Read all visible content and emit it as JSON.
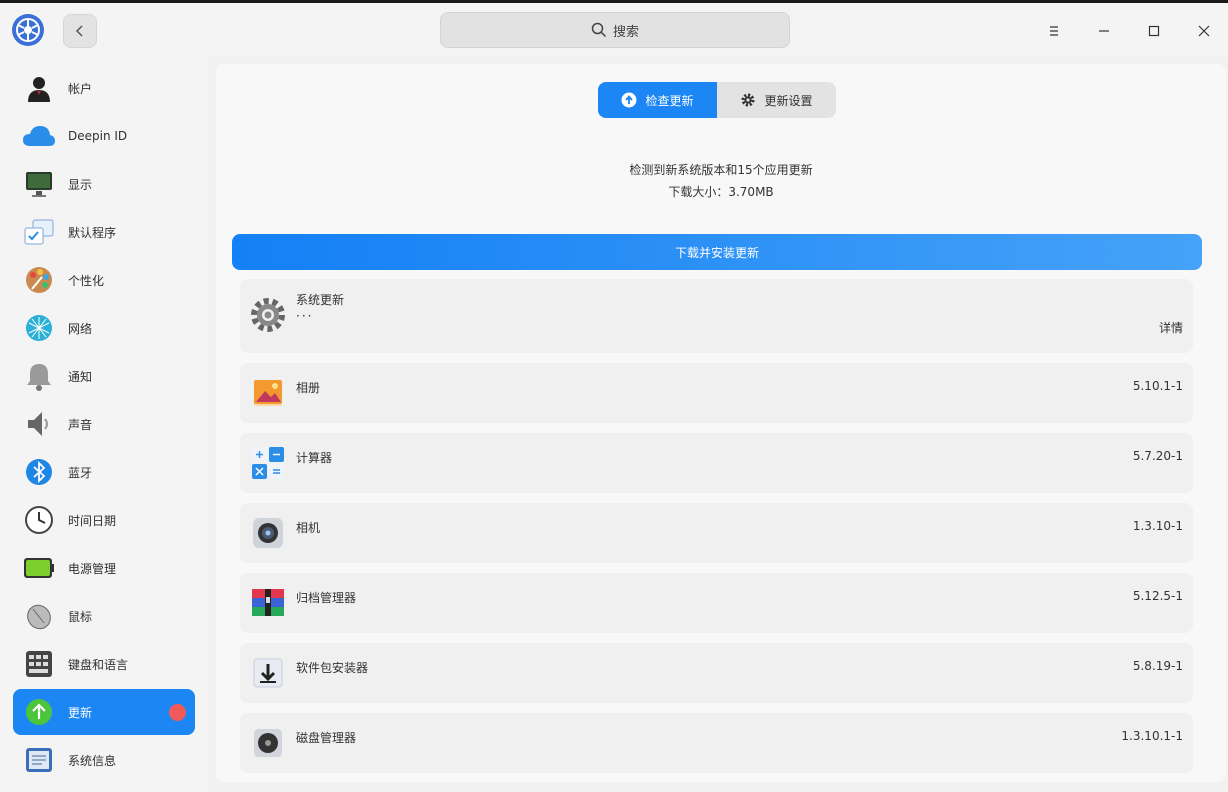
{
  "titlebar": {
    "search_placeholder": "搜索"
  },
  "sidebar": {
    "items": [
      {
        "label": "帐户",
        "icon": "account-icon"
      },
      {
        "label": "Deepin ID",
        "icon": "cloud-icon"
      },
      {
        "label": "显示",
        "icon": "display-icon"
      },
      {
        "label": "默认程序",
        "icon": "default-apps-icon"
      },
      {
        "label": "个性化",
        "icon": "palette-icon"
      },
      {
        "label": "网络",
        "icon": "network-icon"
      },
      {
        "label": "通知",
        "icon": "bell-icon"
      },
      {
        "label": "声音",
        "icon": "speaker-icon"
      },
      {
        "label": "蓝牙",
        "icon": "bluetooth-icon"
      },
      {
        "label": "时间日期",
        "icon": "clock-icon"
      },
      {
        "label": "电源管理",
        "icon": "battery-icon"
      },
      {
        "label": "鼠标",
        "icon": "mouse-icon"
      },
      {
        "label": "键盘和语言",
        "icon": "keyboard-icon"
      },
      {
        "label": "更新",
        "icon": "update-icon",
        "active": true
      },
      {
        "label": "系统信息",
        "icon": "system-info-icon"
      }
    ]
  },
  "main": {
    "tabs": [
      {
        "label": "检查更新",
        "active": true
      },
      {
        "label": "更新设置",
        "active": false
      }
    ],
    "status_line": "检测到新系统版本和15个应用更新",
    "download_size": "下载大小：3.70MB",
    "install_button": "下载并安装更新",
    "system_update": {
      "name": "系统更新",
      "dots": "···",
      "detail": "详情"
    },
    "updates": [
      {
        "name": "相册",
        "version": "5.10.1-1",
        "icon": "album-icon"
      },
      {
        "name": "计算器",
        "version": "5.7.20-1",
        "icon": "calculator-icon"
      },
      {
        "name": "相机",
        "version": "1.3.10-1",
        "icon": "camera-icon"
      },
      {
        "name": "归档管理器",
        "version": "5.12.5-1",
        "icon": "archive-icon"
      },
      {
        "name": "软件包安装器",
        "version": "5.8.19-1",
        "icon": "package-installer-icon"
      },
      {
        "name": "磁盘管理器",
        "version": "1.3.10.1-1",
        "icon": "disk-manager-icon"
      }
    ]
  },
  "colors": {
    "accent": "#1b86f4",
    "badge": "#f25a5a"
  }
}
